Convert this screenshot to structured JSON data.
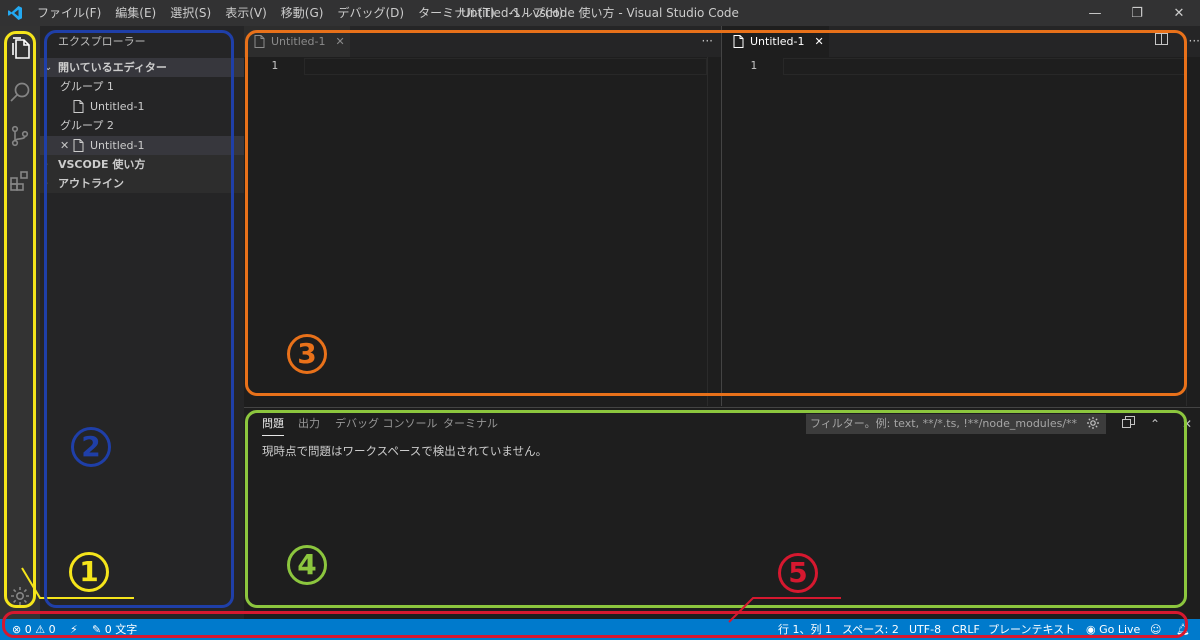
{
  "titlebar": {
    "menu": [
      "ファイル(F)",
      "編集(E)",
      "選択(S)",
      "表示(V)",
      "移動(G)",
      "デバッグ(D)",
      "ターミナル(T)",
      "ヘルプ(H)"
    ],
    "title": "Untitled-1 - vscode 使い方 - Visual Studio Code",
    "minimize": "—",
    "restore": "❐",
    "close": "✕"
  },
  "activitybar": {
    "icons": [
      "files-icon",
      "search-icon",
      "source-control-icon",
      "extensions-icon",
      "gear-icon"
    ]
  },
  "sidebar": {
    "title": "エクスプローラー",
    "open_editors": "開いているエディター",
    "group1": "グループ 1",
    "group1_file": "Untitled-1",
    "group2": "グループ 2",
    "group2_file": "Untitled-1",
    "workspace": "VSCODE 使い方",
    "outline": "アウトライン"
  },
  "editor": {
    "left_tab": "Untitled-1",
    "right_tab": "Untitled-1",
    "line_number": "1",
    "more": "···"
  },
  "panel": {
    "tabs": [
      "問題",
      "出力",
      "デバッグ コンソール",
      "ターミナル"
    ],
    "filter_placeholder": "フィルター。例: text, **/*.ts, !**/node_modules/**",
    "message": "現時点で問題はワークスペースで検出されていません。"
  },
  "statusbar": {
    "errors": "0",
    "warnings": "0",
    "words": "0 文字",
    "position": "行 1、列 1",
    "spaces": "スペース: 2",
    "encoding": "UTF-8",
    "eol": "CRLF",
    "language": "プレーンテキスト",
    "golive": "Go Live"
  },
  "annotations": {
    "n1": "1",
    "n2": "2",
    "n3": "3",
    "n4": "4",
    "n5": "5",
    "colors": {
      "yellow": "#f5e51b",
      "blue": "#1f3fa8",
      "orange": "#e8711a",
      "green": "#8cc63e",
      "red": "#d6182f"
    }
  },
  "colors": {
    "accent": "#007acc",
    "titlebar": "#323233",
    "activitybar": "#333333",
    "sidebar": "#252526",
    "editor": "#1e1e1e"
  }
}
